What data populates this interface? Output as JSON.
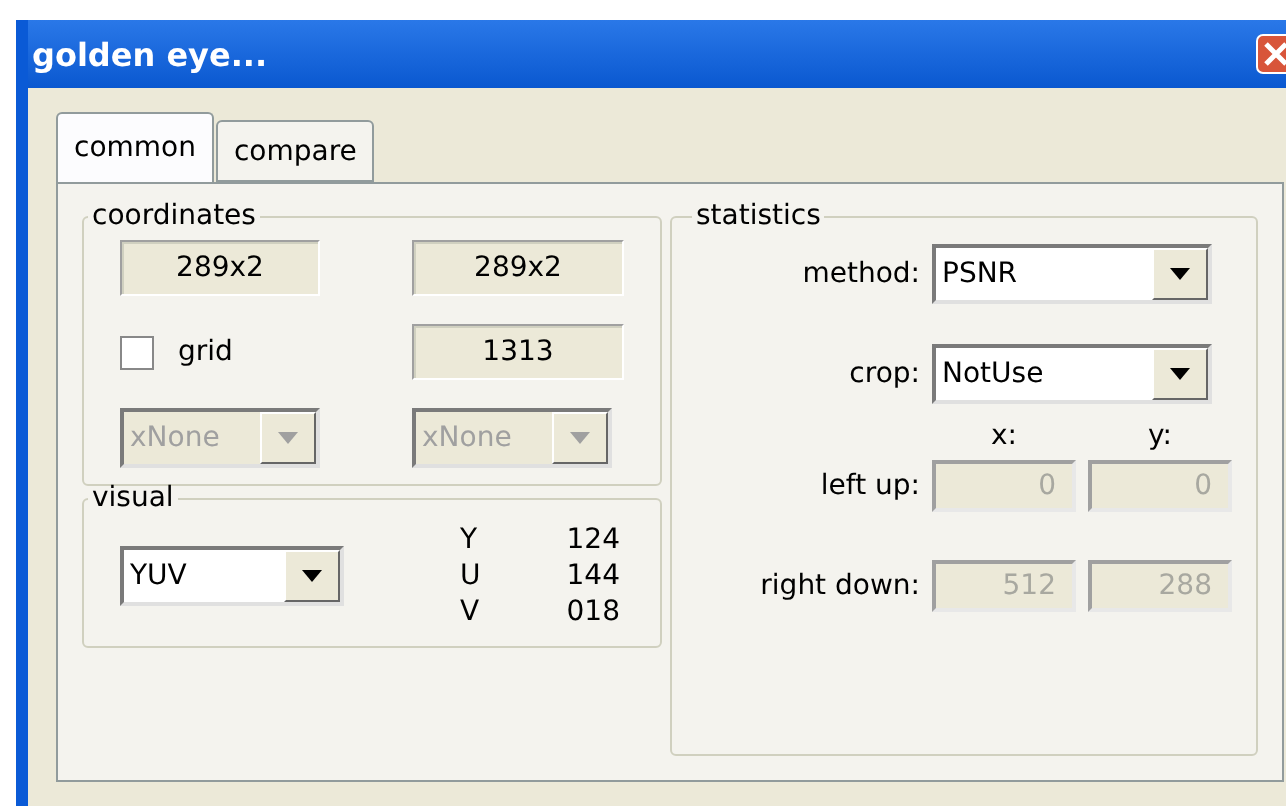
{
  "window": {
    "title": "golden eye..."
  },
  "tabs": [
    {
      "label": "common",
      "selected": true
    },
    {
      "label": "compare",
      "selected": false
    }
  ],
  "coordinates": {
    "title": "coordinates",
    "fields": [
      "289x2",
      "289x2"
    ],
    "grid": {
      "label": "grid",
      "checked": false
    },
    "count": "1313",
    "selects": [
      {
        "value": "xNone",
        "disabled": true
      },
      {
        "value": "xNone",
        "disabled": true
      }
    ]
  },
  "visual": {
    "title": "visual",
    "select": {
      "value": "YUV",
      "disabled": false
    },
    "channels": [
      {
        "name": "Y",
        "value": "124"
      },
      {
        "name": "U",
        "value": "144"
      },
      {
        "name": "V",
        "value": "018"
      }
    ]
  },
  "statistics": {
    "title": "statistics",
    "method": {
      "label": "method:",
      "value": "PSNR"
    },
    "crop": {
      "label": "crop:",
      "value": "NotUse"
    },
    "column_headers": [
      "x:",
      "y:"
    ],
    "rows": [
      {
        "label": "left up:",
        "values": [
          "0",
          "0"
        ],
        "disabled": true
      },
      {
        "label": "right down:",
        "values": [
          "512",
          "288"
        ],
        "disabled": true
      }
    ]
  }
}
